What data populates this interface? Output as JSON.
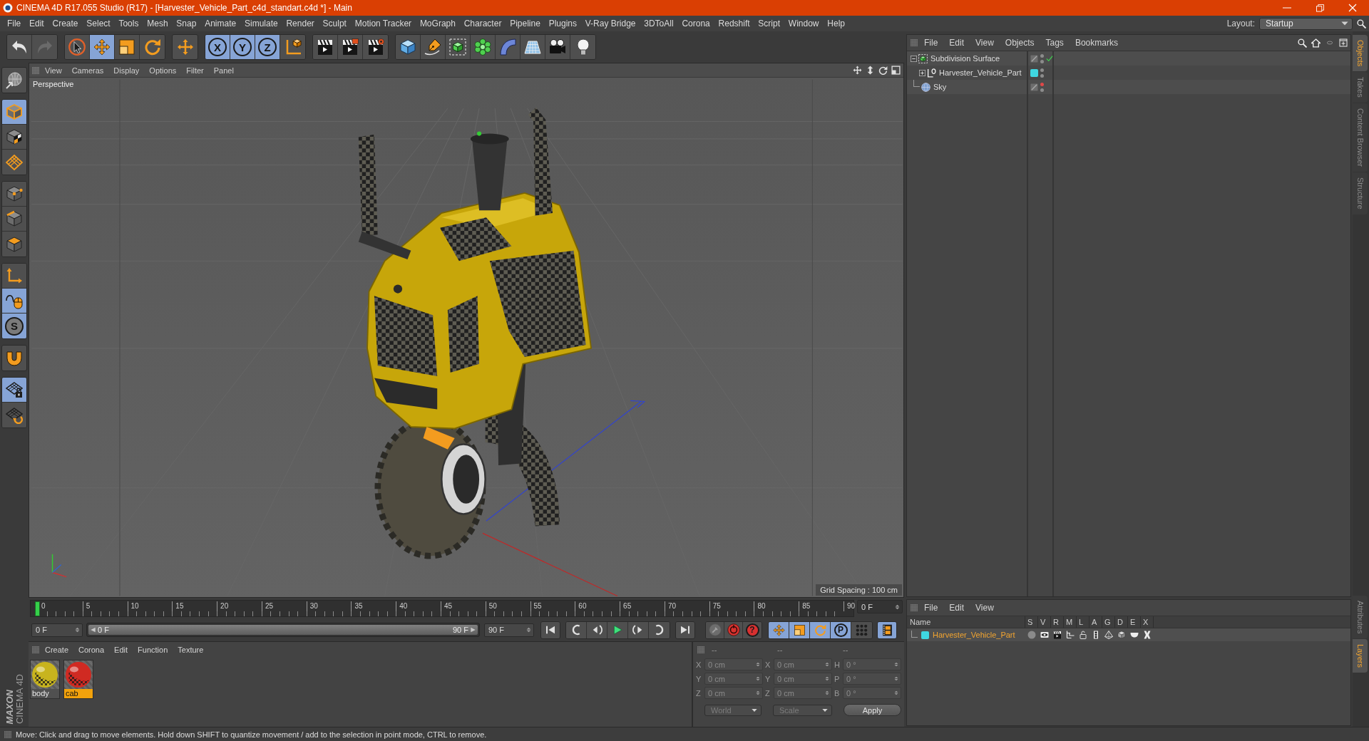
{
  "window": {
    "title": "CINEMA 4D R17.055 Studio (R17) - [Harvester_Vehicle_Part_c4d_standart.c4d *] - Main"
  },
  "menu_bar": [
    "File",
    "Edit",
    "Create",
    "Select",
    "Tools",
    "Mesh",
    "Snap",
    "Animate",
    "Simulate",
    "Render",
    "Sculpt",
    "Motion Tracker",
    "MoGraph",
    "Character",
    "Pipeline",
    "Plugins",
    "V-Ray Bridge",
    "3DToAll",
    "Corona",
    "Redshift",
    "Script",
    "Window",
    "Help"
  ],
  "layout": {
    "label": "Layout:",
    "value": "Startup"
  },
  "toolbar": [
    [
      {
        "kind": "undo",
        "disabled": false
      },
      {
        "kind": "redo",
        "disabled": true
      }
    ],
    [
      {
        "kind": "select",
        "selected": false
      },
      {
        "kind": "move",
        "selected": true
      },
      {
        "kind": "scale",
        "selected": false
      },
      {
        "kind": "rotate",
        "selected": false
      }
    ],
    [
      {
        "kind": "recent",
        "selected": false
      }
    ],
    [
      {
        "kind": "axis",
        "label": "X",
        "selected": true
      },
      {
        "kind": "axis",
        "label": "Y",
        "selected": true
      },
      {
        "kind": "axis",
        "label": "Z",
        "selected": true
      },
      {
        "kind": "coords",
        "selected": false
      }
    ],
    [
      {
        "kind": "render-view"
      },
      {
        "kind": "render-picture"
      },
      {
        "kind": "render-settings"
      }
    ],
    [
      {
        "kind": "cube"
      },
      {
        "kind": "pen"
      },
      {
        "kind": "subdivision"
      },
      {
        "kind": "cloner"
      },
      {
        "kind": "bend"
      },
      {
        "kind": "floor"
      },
      {
        "kind": "camera"
      },
      {
        "kind": "light"
      }
    ]
  ],
  "left_tools": [
    [
      {
        "kind": "make-editable",
        "selected": false
      }
    ],
    [
      {
        "kind": "model",
        "selected": true
      },
      {
        "kind": "texture",
        "selected": false
      },
      {
        "kind": "workplane",
        "selected": false
      }
    ],
    [
      {
        "kind": "points",
        "selected": false
      },
      {
        "kind": "edges",
        "selected": false
      },
      {
        "kind": "polygons",
        "selected": false
      }
    ],
    [
      {
        "kind": "axis-mode",
        "selected": false
      },
      {
        "kind": "tweak",
        "selected": true
      },
      {
        "kind": "solo",
        "label": "S",
        "selected": true
      }
    ],
    [
      {
        "kind": "snap",
        "selected": false
      }
    ],
    [
      {
        "kind": "lock-workplane",
        "selected": true
      },
      {
        "kind": "planar-workplane",
        "selected": false
      }
    ]
  ],
  "viewport": {
    "menu": [
      "View",
      "Cameras",
      "Display",
      "Options",
      "Filter",
      "Panel"
    ],
    "camera": "Perspective",
    "grid_spacing": "Grid Spacing : 100 cm"
  },
  "timeline": {
    "ticks": [
      "0",
      "5",
      "10",
      "15",
      "20",
      "25",
      "30",
      "35",
      "40",
      "45",
      "50",
      "55",
      "60",
      "65",
      "70",
      "75",
      "80",
      "85",
      "90"
    ],
    "level": 0,
    "frame": "0 F",
    "start": "0 F",
    "range": {
      "level": 1,
      "start": "0 F",
      "end": "90 F"
    },
    "end": "90 F",
    "transport": [
      [
        {
          "kind": "go-start"
        }
      ],
      [
        {
          "kind": "prev-key"
        },
        {
          "kind": "prev-frame"
        },
        {
          "kind": "play"
        },
        {
          "kind": "next-frame"
        },
        {
          "kind": "next-key"
        }
      ],
      [
        {
          "kind": "go-end"
        }
      ]
    ],
    "record": [
      {
        "kind": "record",
        "disabled": true
      },
      {
        "kind": "autokey",
        "disabled": false
      },
      {
        "kind": "key-help",
        "label": "?",
        "disabled": false
      }
    ],
    "keys": [
      {
        "kind": "key-move",
        "selected": true
      },
      {
        "kind": "key-scale",
        "selected": true
      },
      {
        "kind": "key-rotate",
        "selected": true
      },
      {
        "kind": "key-param",
        "label": "P",
        "selected": true
      },
      {
        "kind": "key-points",
        "selected": false
      }
    ],
    "film": {
      "selected": true
    }
  },
  "materials": {
    "menu": [
      "Create",
      "Corona",
      "Edit",
      "Function",
      "Texture"
    ],
    "items": [
      {
        "name": "body",
        "color": "#c8b41e",
        "selected": false
      },
      {
        "name": "cab",
        "color": "#d02a22",
        "selected": true
      }
    ]
  },
  "coordinates": {
    "disabled": true,
    "headers": [
      "--",
      "--",
      "--"
    ],
    "rows": [
      [
        {
          "axis": "X",
          "value": "0 cm"
        },
        {
          "axis": "X",
          "value": "0 cm"
        },
        {
          "axis": "H",
          "value": "0 °"
        }
      ],
      [
        {
          "axis": "Y",
          "value": "0 cm"
        },
        {
          "axis": "Y",
          "value": "0 cm"
        },
        {
          "axis": "P",
          "value": "0 °"
        }
      ],
      [
        {
          "axis": "Z",
          "value": "0 cm"
        },
        {
          "axis": "Z",
          "value": "0 cm"
        },
        {
          "axis": "B",
          "value": "0 °"
        }
      ]
    ],
    "mode": "World",
    "size_mode": "Scale",
    "apply": "Apply"
  },
  "objects": {
    "menu": [
      "File",
      "Edit",
      "View",
      "Objects",
      "Tags",
      "Bookmarks"
    ],
    "tree": [
      {
        "name": "Subdivision Surface",
        "kind": "subdivision",
        "expanded": true,
        "hidden_in_editor": false,
        "hidden_in_render": false,
        "enabled": true,
        "children": [
          {
            "name": "Harvester_Vehicle_Part",
            "kind": "null",
            "expanded": false,
            "color": "#3fd6e0",
            "hidden_in_editor": false,
            "hidden_in_render": false
          }
        ]
      },
      {
        "name": "Sky",
        "kind": "sky",
        "hidden_in_editor": true,
        "hidden_in_render": false
      }
    ]
  },
  "layers": {
    "menu": [
      "File",
      "Edit",
      "View"
    ],
    "columns": [
      "Name",
      "S",
      "V",
      "R",
      "M",
      "L",
      "A",
      "G",
      "D",
      "E",
      "X"
    ],
    "rows": [
      {
        "name": "Harvester_Vehicle_Part",
        "color": "#3fd6e0",
        "selected": true,
        "flags": [
          {
            "kind": "solo"
          },
          {
            "kind": "view"
          },
          {
            "kind": "render"
          },
          {
            "kind": "manager"
          },
          {
            "kind": "lock"
          },
          {
            "kind": "animation"
          },
          {
            "kind": "generators"
          },
          {
            "kind": "deformers"
          },
          {
            "kind": "expressions"
          },
          {
            "kind": "xref"
          }
        ]
      }
    ]
  },
  "side_tabs": {
    "top": [
      {
        "label": "Objects",
        "selected": true
      },
      {
        "label": "Takes",
        "selected": false
      },
      {
        "label": "Content Browser",
        "selected": false
      },
      {
        "label": "Structure",
        "selected": false
      }
    ],
    "bottom": [
      {
        "label": "Attributes",
        "selected": false
      },
      {
        "label": "Layers",
        "selected": true
      }
    ]
  },
  "logo": {
    "brand": "MAXON",
    "product": "CINEMA 4D"
  },
  "status_bar": "Move: Click and drag to move elements. Hold down SHIFT to quantize movement / add to the selection in point mode, CTRL to remove."
}
